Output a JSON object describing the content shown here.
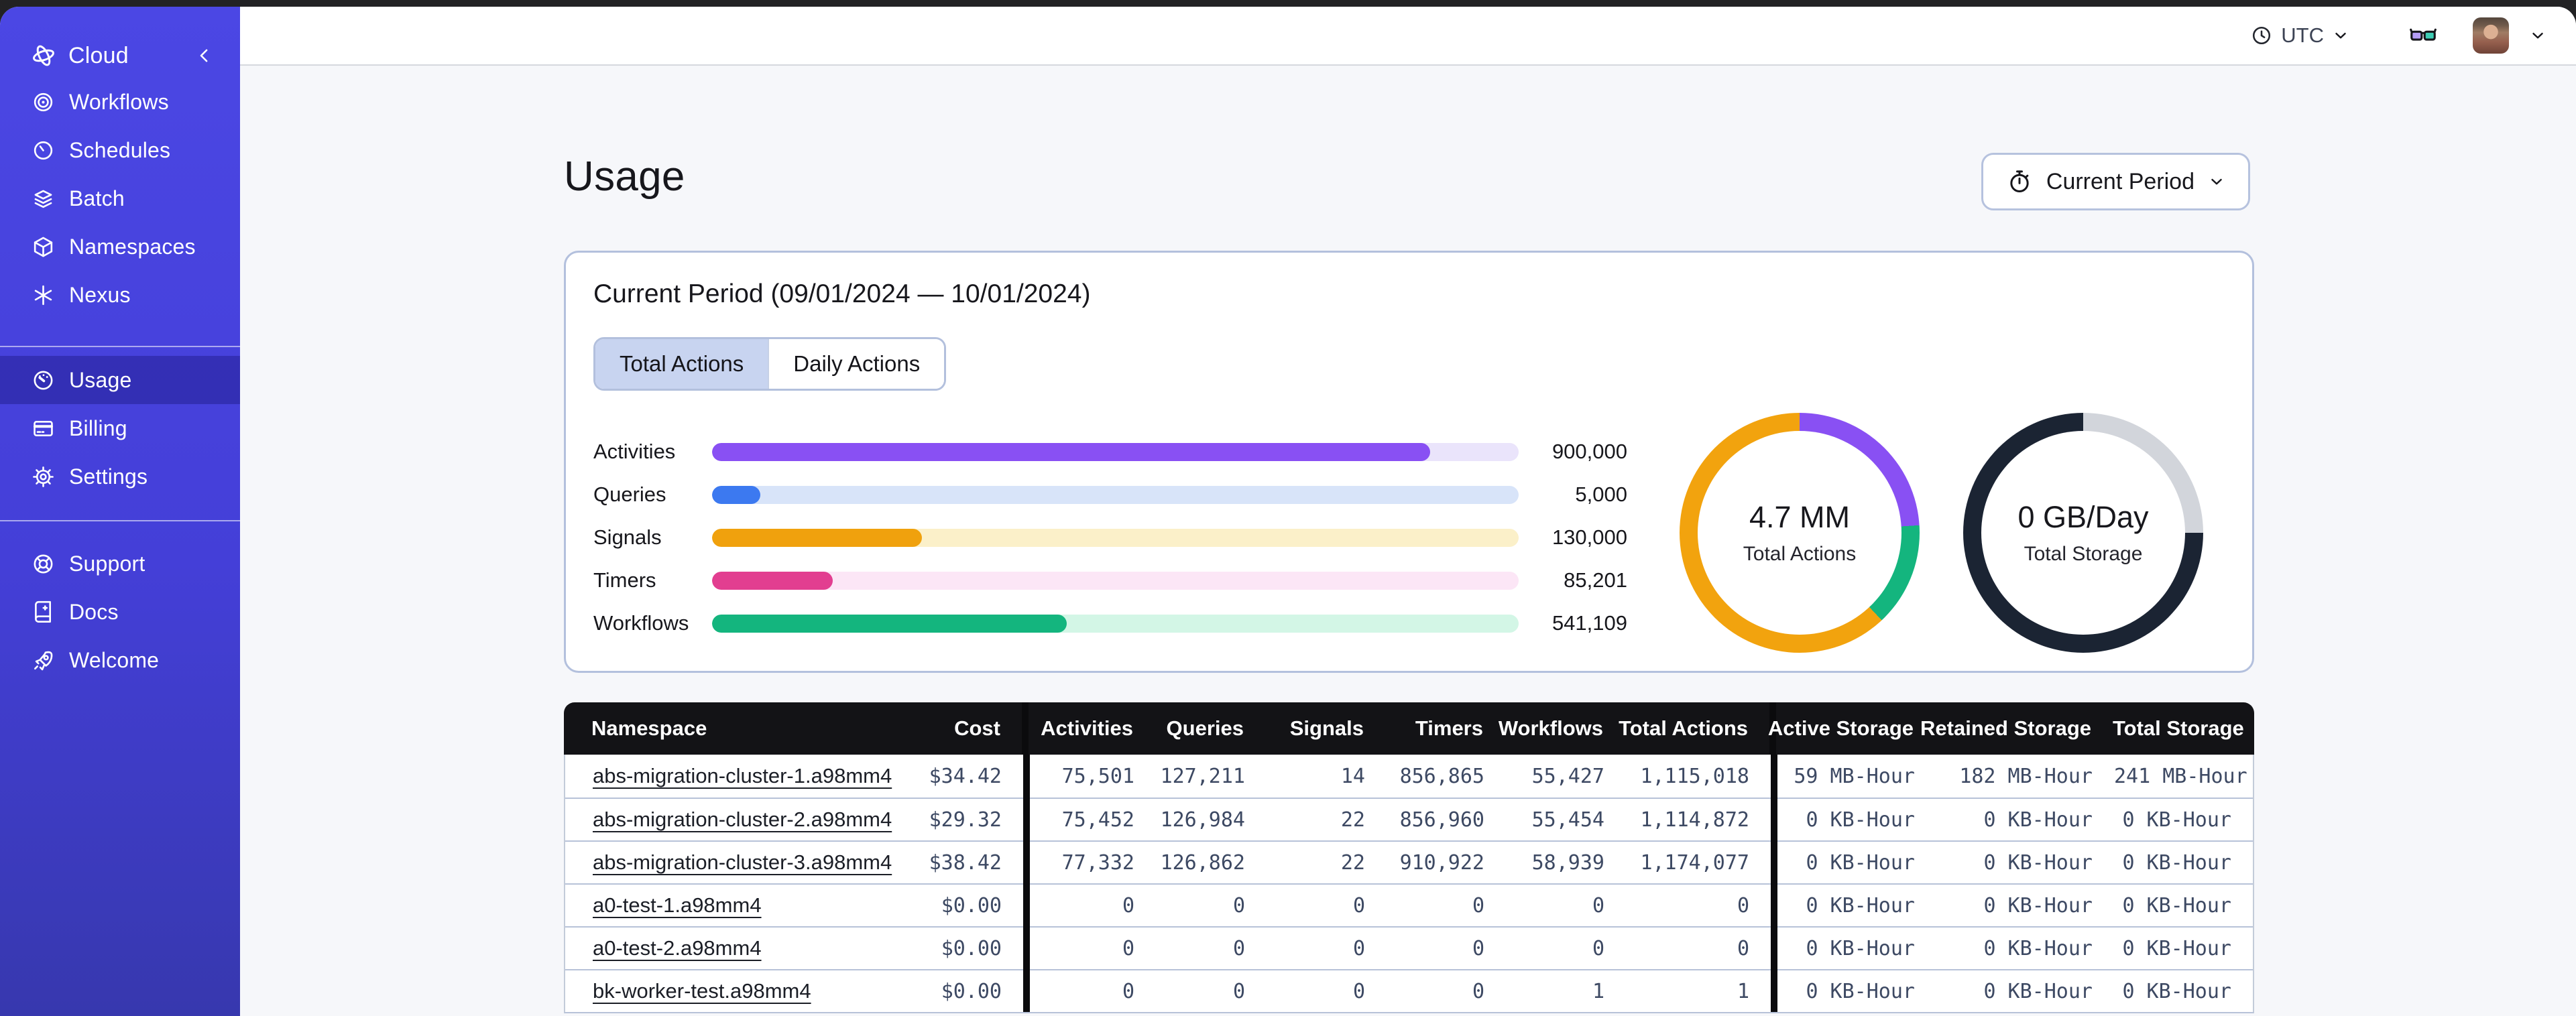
{
  "sidebar": {
    "brand_label": "Cloud",
    "nav_top": [
      {
        "label": "Workflows",
        "icon": "workflows"
      },
      {
        "label": "Schedules",
        "icon": "schedules"
      },
      {
        "label": "Batch",
        "icon": "batch"
      },
      {
        "label": "Namespaces",
        "icon": "namespaces"
      },
      {
        "label": "Nexus",
        "icon": "nexus"
      }
    ],
    "nav_middle": [
      {
        "label": "Usage",
        "icon": "usage",
        "active": true
      },
      {
        "label": "Billing",
        "icon": "billing"
      },
      {
        "label": "Settings",
        "icon": "settings"
      }
    ],
    "nav_bottom": [
      {
        "label": "Support",
        "icon": "support"
      },
      {
        "label": "Docs",
        "icon": "docs"
      },
      {
        "label": "Welcome",
        "icon": "welcome"
      }
    ]
  },
  "topbar": {
    "timezone": "UTC"
  },
  "page": {
    "title": "Usage",
    "period_button_label": "Current Period"
  },
  "usage_card": {
    "title": "Current Period (09/01/2024 — 10/01/2024)",
    "tabs": [
      {
        "label": "Total Actions",
        "active": true
      },
      {
        "label": "Daily Actions",
        "active": false
      }
    ]
  },
  "chart_data": [
    {
      "type": "bar",
      "orientation": "horizontal",
      "categories": [
        "Activities",
        "Queries",
        "Signals",
        "Timers",
        "Workflows"
      ],
      "values": [
        900000,
        5000,
        130000,
        85201,
        541109
      ],
      "value_labels": [
        "900,000",
        "5,000",
        "130,000",
        "85,201",
        "541,109"
      ],
      "bar_colors": [
        "#8950f3",
        "#3c79f0",
        "#f0a10d",
        "#e23e90",
        "#14b57e"
      ],
      "track_colors": [
        "#eae4fb",
        "#d8e4f9",
        "#fbf0c9",
        "#fce6f6",
        "#d3f6e6"
      ],
      "fill_percent": [
        89,
        6,
        26,
        15,
        44
      ],
      "title": "",
      "xlabel": "",
      "ylabel": "",
      "grid": false
    },
    {
      "type": "donut",
      "center_value": "4.7 MM",
      "center_label": "Total Actions",
      "segments": [
        {
          "name": "purple-segment",
          "color": "#8950f3",
          "percent": 24
        },
        {
          "name": "green-segment",
          "color": "#14b57e",
          "percent": 14
        },
        {
          "name": "orange-segment",
          "color": "#f2a30e",
          "percent": 62
        }
      ]
    },
    {
      "type": "donut",
      "center_value": "0 GB/Day",
      "center_label": "Total Storage",
      "segments": [
        {
          "name": "light-segment",
          "color": "#d2d5db",
          "percent": 25
        },
        {
          "name": "dark-segment",
          "color": "#1b2433",
          "percent": 75
        }
      ]
    }
  ],
  "table": {
    "columns": [
      {
        "key": "namespace",
        "label": "Namespace",
        "align": "left"
      },
      {
        "key": "cost",
        "label": "Cost",
        "align": "right"
      },
      {
        "key": "_div1",
        "label": "",
        "divider": true
      },
      {
        "key": "activities",
        "label": "Activities",
        "align": "right"
      },
      {
        "key": "queries",
        "label": "Queries",
        "align": "right"
      },
      {
        "key": "signals",
        "label": "Signals",
        "align": "right"
      },
      {
        "key": "timers",
        "label": "Timers",
        "align": "right"
      },
      {
        "key": "workflows",
        "label": "Workflows",
        "align": "right"
      },
      {
        "key": "total_actions",
        "label": "Total Actions",
        "align": "right"
      },
      {
        "key": "_div2",
        "label": "",
        "divider": true
      },
      {
        "key": "active_storage",
        "label": "Active Storage",
        "align": "right"
      },
      {
        "key": "retained_storage",
        "label": "Retained Storage",
        "align": "right"
      },
      {
        "key": "total_storage",
        "label": "Total Storage",
        "align": "right"
      }
    ],
    "rows": [
      {
        "namespace": "abs-migration-cluster-1.a98mm4",
        "cost": "$34.42",
        "activities": "75,501",
        "queries": "127,211",
        "signals": "14",
        "timers": "856,865",
        "workflows": "55,427",
        "total_actions": "1,115,018",
        "active_storage": "59 MB-Hour",
        "retained_storage": "182 MB-Hour",
        "total_storage": "241 MB-Hour"
      },
      {
        "namespace": "abs-migration-cluster-2.a98mm4",
        "cost": "$29.32",
        "activities": "75,452",
        "queries": "126,984",
        "signals": "22",
        "timers": "856,960",
        "workflows": "55,454",
        "total_actions": "1,114,872",
        "active_storage": "0 KB-Hour",
        "retained_storage": "0 KB-Hour",
        "total_storage": "0 KB-Hour"
      },
      {
        "namespace": "abs-migration-cluster-3.a98mm4",
        "cost": "$38.42",
        "activities": "77,332",
        "queries": "126,862",
        "signals": "22",
        "timers": "910,922",
        "workflows": "58,939",
        "total_actions": "1,174,077",
        "active_storage": "0 KB-Hour",
        "retained_storage": "0 KB-Hour",
        "total_storage": "0 KB-Hour"
      },
      {
        "namespace": "a0-test-1.a98mm4",
        "cost": "$0.00",
        "activities": "0",
        "queries": "0",
        "signals": "0",
        "timers": "0",
        "workflows": "0",
        "total_actions": "0",
        "active_storage": "0 KB-Hour",
        "retained_storage": "0 KB-Hour",
        "total_storage": "0 KB-Hour"
      },
      {
        "namespace": "a0-test-2.a98mm4",
        "cost": "$0.00",
        "activities": "0",
        "queries": "0",
        "signals": "0",
        "timers": "0",
        "workflows": "0",
        "total_actions": "0",
        "active_storage": "0 KB-Hour",
        "retained_storage": "0 KB-Hour",
        "total_storage": "0 KB-Hour"
      },
      {
        "namespace": "bk-worker-test.a98mm4",
        "cost": "$0.00",
        "activities": "0",
        "queries": "0",
        "signals": "0",
        "timers": "0",
        "workflows": "1",
        "total_actions": "1",
        "active_storage": "0 KB-Hour",
        "retained_storage": "0 KB-Hour",
        "total_storage": "0 KB-Hour"
      }
    ]
  },
  "colors": {
    "sidebar_top": "#4b47e4",
    "sidebar_bottom": "#3738ae",
    "content_bg": "#f6f7fa",
    "table_header_bg": "#131316",
    "card_border": "#b3c0dd",
    "tab_active_bg": "#c8d4f0"
  }
}
